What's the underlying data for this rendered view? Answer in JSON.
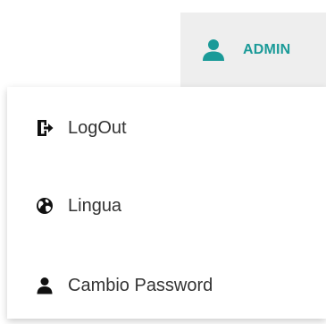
{
  "header": {
    "user_button": {
      "label": "ADMIN",
      "icon": "user-icon",
      "color": "#1a9a98"
    }
  },
  "dropdown": {
    "items": [
      {
        "label": "LogOut",
        "icon": "logout-icon"
      },
      {
        "label": "Lingua",
        "icon": "globe-icon"
      },
      {
        "label": "Cambio Password",
        "icon": "user-icon"
      }
    ]
  }
}
